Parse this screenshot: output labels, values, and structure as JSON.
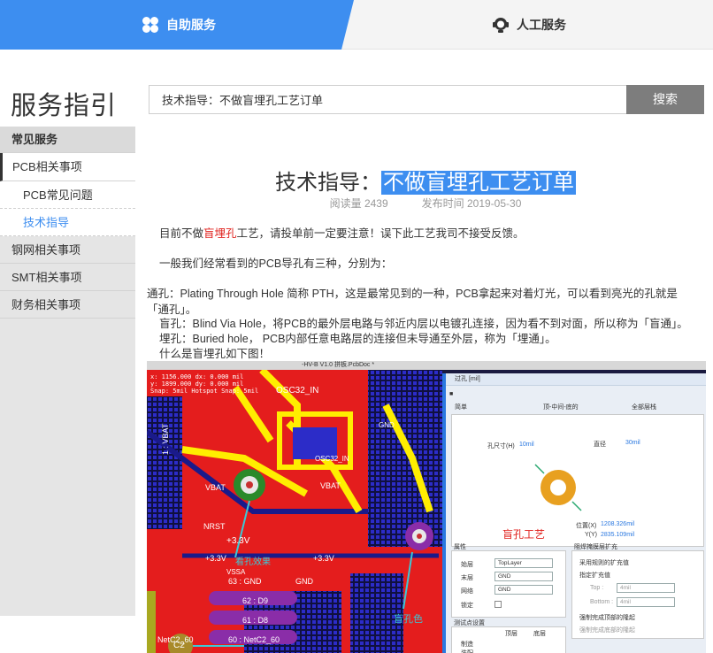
{
  "tabs": {
    "self_service": "自助服务",
    "human_service": "人工服务"
  },
  "sidebar": {
    "title": "服务指引",
    "items": [
      {
        "label": "常见服务"
      },
      {
        "label": "PCB相关事项"
      },
      {
        "label": "PCB常见问题"
      },
      {
        "label": "技术指导"
      },
      {
        "label": "钢网相关事项"
      },
      {
        "label": "SMT相关事项"
      },
      {
        "label": "财务相关事项"
      }
    ]
  },
  "search": {
    "value": "技术指导：不做盲埋孔工艺订单",
    "button": "搜索"
  },
  "article": {
    "title_prefix": "技术指导：",
    "title_highlight": "不做盲埋孔工艺订单",
    "reads": "阅读量 2439",
    "published": "发布时间 2019-05-30",
    "p1_a": "目前不做",
    "p1_red": "盲埋孔",
    "p1_b": "工艺，请投单前一定要注意！误下此工艺我司不接受反馈。",
    "p2": "一般我们经常看到的PCB导孔有三种，分别为：",
    "p3": "通孔：Plating Through Hole 简称 PTH，这是最常见到的一种，PCB拿起来对着灯光，可以看到亮光的孔就是「通孔」。",
    "p4": "盲孔：Blind Via Hole，将PCB的最外层电路与邻近内层以电镀孔连接，因为看不到对面，所以称为「盲通」。",
    "p5": "埋孔：Buried hole， PCB内部任意电路层的连接但未导通至外层，称为「埋通」。",
    "p6": "什么是盲埋孔如下图！"
  },
  "figure": {
    "doc_title": "-HV-B V1.0 拼板.PcbDoc *",
    "coords": [
      "x: 1156.000  dx:  0.000 mil",
      "y: 1899.000  dy: 0.000 mil",
      "Snap: 5mil Hotspot Snap: 5mil"
    ],
    "dialog_title": "过孔 [mil]",
    "radio_simple": "简单",
    "radio_top": "顶-中间-底的",
    "radio_full": "全部层栈",
    "hole_size": "孔尺寸(H)",
    "hole_value": "10mil",
    "diameter": "直径",
    "diameter_value": "30mil",
    "location_x": "位置(X)",
    "location_x_value": "1208.326mil",
    "location_y": "Y(Y)",
    "location_y_value": "2835.109mil",
    "caption_blind": "盲孔工艺",
    "caption_hole": "盲孔色",
    "props_header": "属性",
    "start_layer_label": "始层",
    "start_layer_value": "TopLayer",
    "end_layer_label": "末层",
    "end_layer_value": "GND",
    "net_label": "网络",
    "net_value": "GND",
    "lock_label": "锁定",
    "mask_header": "阻焊掩膜层扩充",
    "mask_opt1": "采用规则的扩充值",
    "mask_opt2": "指定扩充值",
    "mask_top": "Top :",
    "mask_top_value": "4mil",
    "mask_bottom": "Bottom :",
    "mask_bottom_value": "4mil",
    "mask_chk1": "强制完成顶部的隆起",
    "mask_chk2": "强制完成底部的隆起",
    "test_header": "测试点设置",
    "test_top": "顶层",
    "test_bottom": "底层",
    "test_fab": "制造",
    "test_asm": "装配",
    "pcb_labels": [
      "OSC32_IN",
      "GND",
      "VBAT",
      "VBAT",
      "NRST",
      "+3.3V",
      "+3.3V",
      "看孔效果",
      "+3.3V",
      "63 : GND",
      "GND",
      "62 : D9",
      "61 : D8",
      "60 : NetC2_60",
      "NetC2_60",
      "1 : VBAT",
      "VSSA",
      "C2",
      "OSC32_IN"
    ]
  },
  "colors": {
    "accent": "#3d8ef0",
    "highlight_red": "#e0201c",
    "search_button": "#7d7d7d"
  }
}
